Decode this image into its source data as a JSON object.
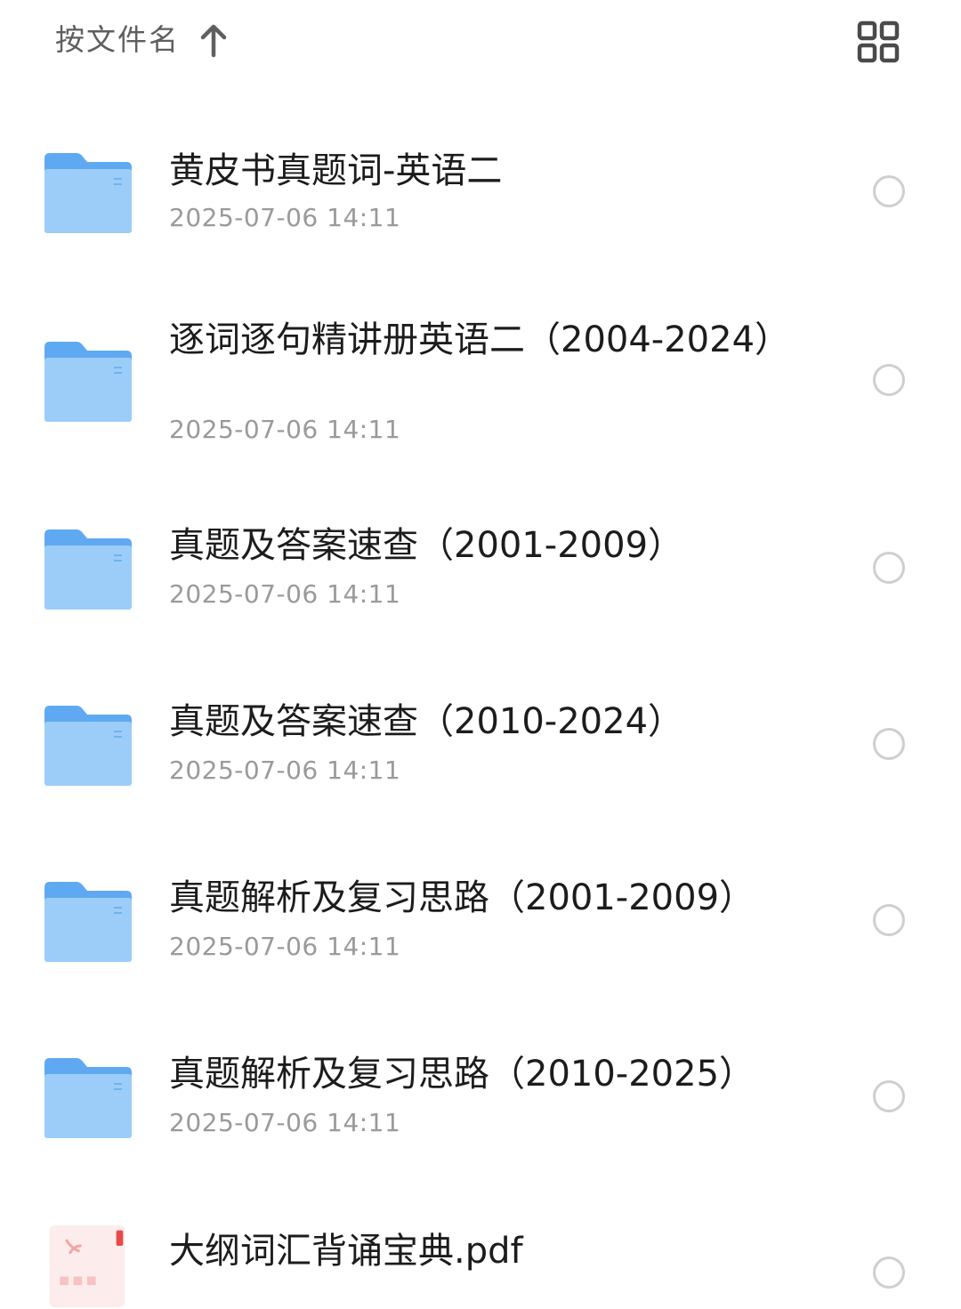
{
  "toolbar": {
    "sort_label": "按文件名",
    "sort_direction_icon": "arrow-up-icon",
    "view_toggle_icon": "grid-view-icon"
  },
  "colors": {
    "folder_back": "#5fa9f2",
    "folder_front": "#9ccdf9",
    "pdf_red": "#e84a4a",
    "text_primary": "#1c1c1c",
    "text_secondary": "#9a9a9a"
  },
  "files": [
    {
      "type": "folder",
      "icon": "folder-icon",
      "name": "黄皮书真题词-英语二",
      "date": "2025-07-06 14:11"
    },
    {
      "type": "folder",
      "icon": "folder-icon",
      "name": "逐词逐句精讲册英语二（2004-2024）",
      "date": "2025-07-06 14:11"
    },
    {
      "type": "folder",
      "icon": "folder-icon",
      "name": "真题及答案速查（2001-2009）",
      "date": "2025-07-06 14:11"
    },
    {
      "type": "folder",
      "icon": "folder-icon",
      "name": "真题及答案速查（2010-2024）",
      "date": "2025-07-06 14:11"
    },
    {
      "type": "folder",
      "icon": "folder-icon",
      "name": "真题解析及复习思路（2001-2009）",
      "date": "2025-07-06 14:11"
    },
    {
      "type": "folder",
      "icon": "folder-icon",
      "name": "真题解析及复习思路（2010-2025）",
      "date": "2025-07-06 14:11"
    },
    {
      "type": "pdf",
      "icon": "pdf-file-icon",
      "name": "大纲词汇背诵宝典.pdf",
      "date": ""
    }
  ]
}
